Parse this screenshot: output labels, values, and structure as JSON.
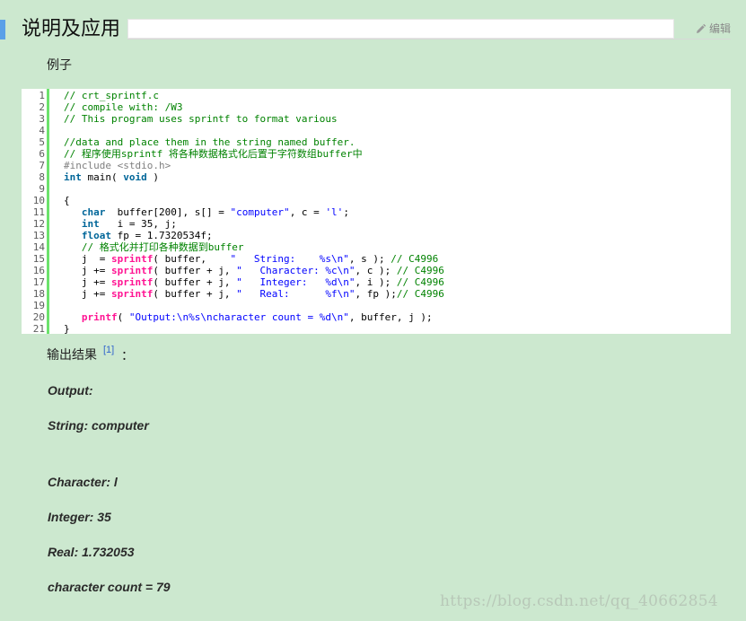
{
  "section": {
    "title": "说明及应用",
    "edit_label": "编辑"
  },
  "example_label": "例子",
  "code_lines": [
    {
      "n": "1",
      "parts": [
        {
          "t": "// crt_sprintf.c",
          "c": "c-com"
        }
      ]
    },
    {
      "n": "2",
      "parts": [
        {
          "t": "// compile with: /W3",
          "c": "c-com"
        }
      ]
    },
    {
      "n": "3",
      "parts": [
        {
          "t": "// This program uses sprintf to format various",
          "c": "c-com"
        }
      ]
    },
    {
      "n": "4",
      "parts": []
    },
    {
      "n": "5",
      "parts": [
        {
          "t": "//data and place them in the string named buffer.",
          "c": "c-com"
        }
      ]
    },
    {
      "n": "6",
      "parts": [
        {
          "t": "// 程序使用sprintf 将各种数据格式化后置于字符数组buffer中",
          "c": "c-com"
        }
      ]
    },
    {
      "n": "7",
      "parts": [
        {
          "t": "#include <stdio.h>",
          "c": "c-pre"
        }
      ]
    },
    {
      "n": "8",
      "parts": [
        {
          "t": "int",
          "c": "c-kw"
        },
        {
          "t": " main( ",
          "c": ""
        },
        {
          "t": "void",
          "c": "c-kw"
        },
        {
          "t": " )",
          "c": ""
        }
      ]
    },
    {
      "n": "9",
      "parts": []
    },
    {
      "n": "10",
      "parts": [
        {
          "t": "{",
          "c": ""
        }
      ]
    },
    {
      "n": "11",
      "parts": [
        {
          "t": "   ",
          "c": ""
        },
        {
          "t": "char",
          "c": "c-kw"
        },
        {
          "t": "  buffer[200], s[] = ",
          "c": ""
        },
        {
          "t": "\"computer\"",
          "c": "c-str"
        },
        {
          "t": ", c = ",
          "c": ""
        },
        {
          "t": "'l'",
          "c": "c-str"
        },
        {
          "t": ";",
          "c": ""
        }
      ]
    },
    {
      "n": "12",
      "parts": [
        {
          "t": "   ",
          "c": ""
        },
        {
          "t": "int",
          "c": "c-kw"
        },
        {
          "t": "   i = 35, j;",
          "c": ""
        }
      ]
    },
    {
      "n": "13",
      "parts": [
        {
          "t": "   ",
          "c": ""
        },
        {
          "t": "float",
          "c": "c-kw"
        },
        {
          "t": " fp = 1.7320534f;",
          "c": ""
        }
      ]
    },
    {
      "n": "14",
      "parts": [
        {
          "t": "   // 格式化并打印各种数据到buffer",
          "c": "c-com"
        }
      ]
    },
    {
      "n": "15",
      "parts": [
        {
          "t": "   j  = ",
          "c": ""
        },
        {
          "t": "sprintf",
          "c": "c-fn"
        },
        {
          "t": "( buffer,    ",
          "c": ""
        },
        {
          "t": "\"   String:    %s\\n\"",
          "c": "c-str"
        },
        {
          "t": ", s ); ",
          "c": ""
        },
        {
          "t": "// C4996",
          "c": "c-com"
        }
      ]
    },
    {
      "n": "16",
      "parts": [
        {
          "t": "   j += ",
          "c": ""
        },
        {
          "t": "sprintf",
          "c": "c-fn"
        },
        {
          "t": "( buffer + j, ",
          "c": ""
        },
        {
          "t": "\"   Character: %c\\n\"",
          "c": "c-str"
        },
        {
          "t": ", c ); ",
          "c": ""
        },
        {
          "t": "// C4996",
          "c": "c-com"
        }
      ]
    },
    {
      "n": "17",
      "parts": [
        {
          "t": "   j += ",
          "c": ""
        },
        {
          "t": "sprintf",
          "c": "c-fn"
        },
        {
          "t": "( buffer + j, ",
          "c": ""
        },
        {
          "t": "\"   Integer:   %d\\n\"",
          "c": "c-str"
        },
        {
          "t": ", i ); ",
          "c": ""
        },
        {
          "t": "// C4996",
          "c": "c-com"
        }
      ]
    },
    {
      "n": "18",
      "parts": [
        {
          "t": "   j += ",
          "c": ""
        },
        {
          "t": "sprintf",
          "c": "c-fn"
        },
        {
          "t": "( buffer + j, ",
          "c": ""
        },
        {
          "t": "\"   Real:      %f\\n\"",
          "c": "c-str"
        },
        {
          "t": ", fp );",
          "c": ""
        },
        {
          "t": "// C4996",
          "c": "c-com"
        }
      ]
    },
    {
      "n": "19",
      "parts": []
    },
    {
      "n": "20",
      "parts": [
        {
          "t": "   ",
          "c": ""
        },
        {
          "t": "printf",
          "c": "c-fn"
        },
        {
          "t": "( ",
          "c": ""
        },
        {
          "t": "\"Output:\\n%s\\ncharacter count = %d\\n\"",
          "c": "c-str"
        },
        {
          "t": ", buffer, j );",
          "c": ""
        }
      ]
    },
    {
      "n": "21",
      "parts": [
        {
          "t": "}",
          "c": ""
        }
      ]
    }
  ],
  "output": {
    "title": "输出结果",
    "ref": "[1]",
    "colon": "：",
    "lines": [
      "Output:",
      "String: computer",
      "Character: l",
      "Integer: 35",
      "Real: 1.732053",
      "character count = 79"
    ]
  },
  "watermark": "https://blog.csdn.net/qq_40662854"
}
